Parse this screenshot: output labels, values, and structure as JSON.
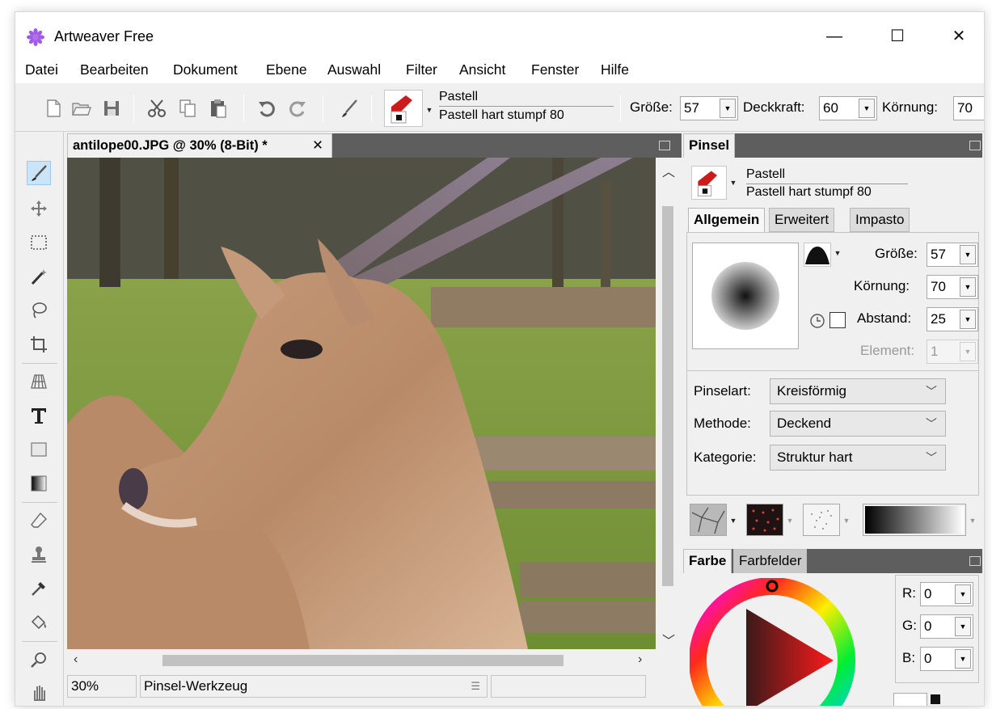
{
  "window": {
    "title": "Artweaver Free",
    "minimize": "—",
    "maximize": "☐",
    "close": "✕"
  },
  "menu": [
    "Datei",
    "Bearbeiten",
    "Dokument",
    "Ebene",
    "Auswahl",
    "Filter",
    "Ansicht",
    "Fenster",
    "Hilfe"
  ],
  "toolbar": {
    "brush_category": "Pastell",
    "brush_variant": "Pastell hart stumpf 80",
    "size_label": "Größe:",
    "size_value": "57",
    "opacity_label": "Deckkraft:",
    "opacity_value": "60",
    "grain_label": "Körnung:",
    "grain_value": "70"
  },
  "document": {
    "tab_title": "antilope00.JPG @ 30% (8-Bit) *",
    "tab_close": "✕",
    "zoom": "30%",
    "status_tool": "Pinsel-Werkzeug"
  },
  "brush_panel": {
    "tab": "Pinsel",
    "category": "Pastell",
    "variant": "Pastell hart stumpf 80",
    "subtabs": [
      "Allgemein",
      "Erweitert",
      "Impasto"
    ],
    "size_label": "Größe:",
    "size_value": "57",
    "grain_label": "Körnung:",
    "grain_value": "70",
    "spacing_label": "Abstand:",
    "spacing_value": "25",
    "element_label": "Element:",
    "element_value": "1",
    "type_label": "Pinselart:",
    "type_value": "Kreisförmig",
    "method_label": "Methode:",
    "method_value": "Deckend",
    "category_label": "Kategorie:",
    "category_value": "Struktur hart"
  },
  "color_panel": {
    "tabs": [
      "Farbe",
      "Farbfelder"
    ],
    "r_label": "R:",
    "r_value": "0",
    "g_label": "G:",
    "g_value": "0",
    "b_label": "B:",
    "b_value": "0"
  },
  "colors": {
    "panel_strip": "#5e5e5e",
    "selection_highlight": "#cce4f7",
    "hue_red": "#ff1a1a"
  }
}
